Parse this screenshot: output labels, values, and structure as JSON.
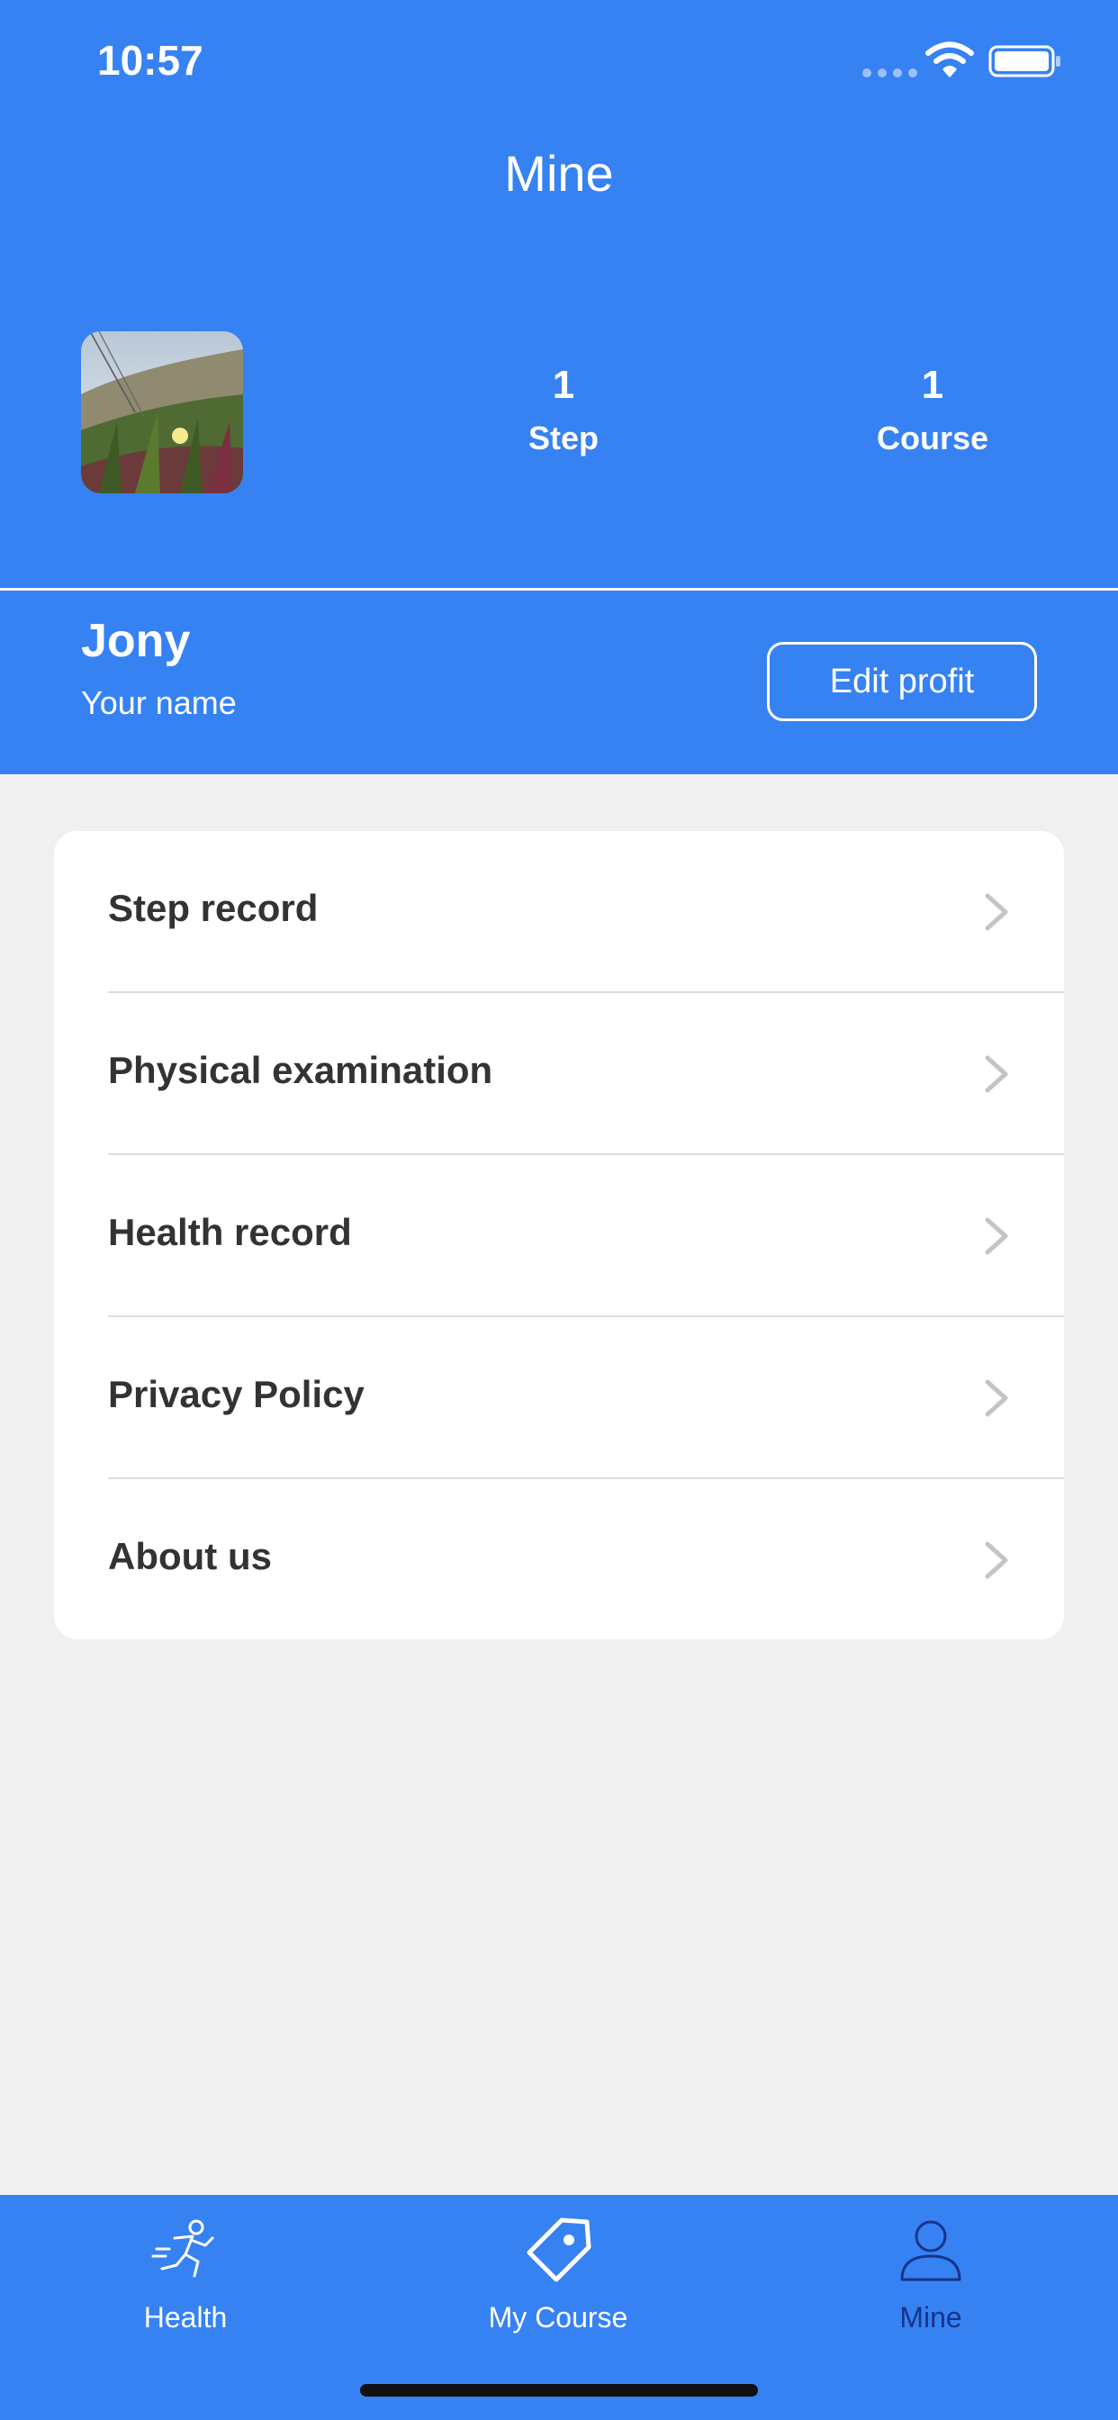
{
  "status_bar": {
    "time": "10:57"
  },
  "header": {
    "title": "Mine"
  },
  "profile": {
    "stats": [
      {
        "value": "1",
        "label": "Step"
      },
      {
        "value": "1",
        "label": "Course"
      }
    ],
    "name": "Jony",
    "subtitle": "Your name",
    "edit_button_label": "Edit profit"
  },
  "menu": {
    "items": [
      {
        "label": "Step record"
      },
      {
        "label": "Physical examination"
      },
      {
        "label": "Health record"
      },
      {
        "label": "Privacy Policy"
      },
      {
        "label": "About us"
      }
    ]
  },
  "tabs": [
    {
      "label": "Health",
      "icon": "running-person-icon"
    },
    {
      "label": "My Course",
      "icon": "tag-icon"
    },
    {
      "label": "Mine",
      "icon": "person-icon"
    }
  ],
  "colors": {
    "primary": "#3682f2",
    "background": "#f0f0f0",
    "active_tab": "#17348a",
    "menu_text": "#333333"
  }
}
